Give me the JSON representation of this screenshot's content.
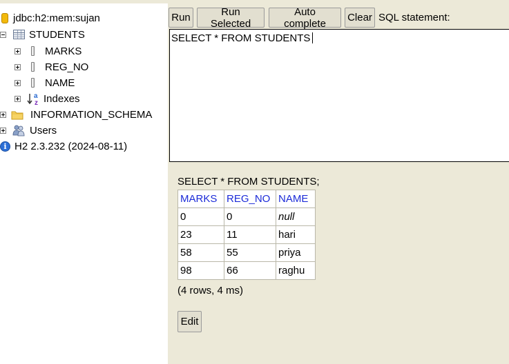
{
  "tree": {
    "connection": "jdbc:h2:mem:sujan",
    "table": "STUDENTS",
    "columns": [
      "MARKS",
      "REG_NO",
      "NAME"
    ],
    "indexes": "Indexes",
    "schema": "INFORMATION_SCHEMA",
    "users": "Users",
    "version": "H2 2.3.232 (2024-08-11)"
  },
  "toolbar": {
    "run": "Run",
    "run_selected": "Run Selected",
    "auto_complete": "Auto complete",
    "clear": "Clear",
    "sql_label": "SQL statement:"
  },
  "editor": {
    "value": "SELECT * FROM STUDENTS"
  },
  "results": {
    "query": "SELECT * FROM STUDENTS;",
    "headers": [
      "MARKS",
      "REG_NO",
      "NAME"
    ],
    "rows": [
      [
        "0",
        "0",
        "null"
      ],
      [
        "23",
        "11",
        "hari"
      ],
      [
        "58",
        "55",
        "priya"
      ],
      [
        "98",
        "66",
        "raghu"
      ]
    ],
    "summary": "(4 rows, 4 ms)",
    "edit_label": "Edit"
  },
  "colors": {
    "panel_bg": "#ece9d8",
    "header_link": "#1c2bd8"
  }
}
